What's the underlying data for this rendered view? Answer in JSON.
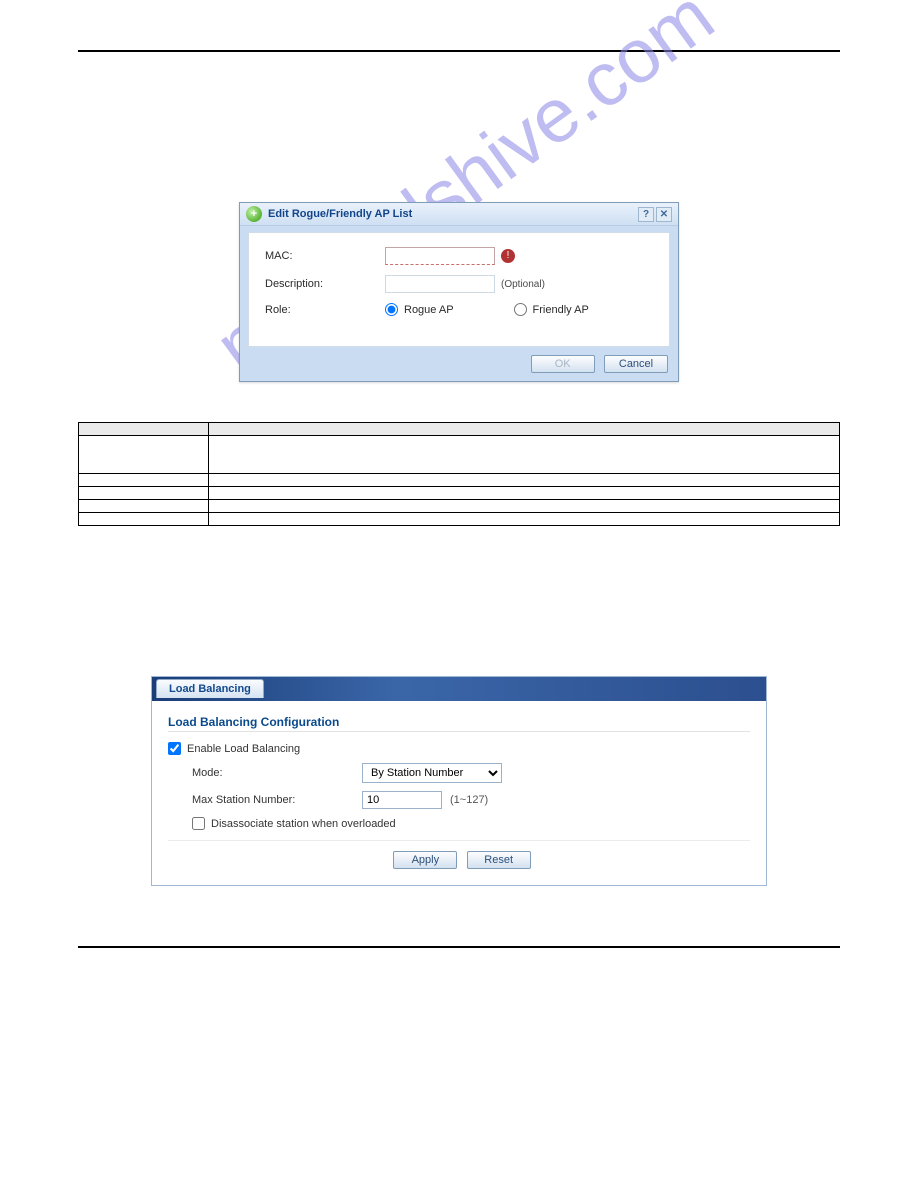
{
  "watermark": "manualshive.com",
  "dialog": {
    "title": "Edit Rogue/Friendly AP List",
    "fields": {
      "mac": {
        "label": "MAC:",
        "value": ""
      },
      "desc": {
        "label": "Description:",
        "value": "",
        "after": "(Optional)"
      },
      "role": {
        "label": "Role:",
        "opt_rogue": "Rogue AP",
        "opt_friendly": "Friendly AP"
      }
    },
    "buttons": {
      "ok": "OK",
      "cancel": "Cancel"
    }
  },
  "table": {
    "head": {
      "label": "",
      "desc": ""
    },
    "rows": [
      {
        "label": "",
        "desc": ""
      },
      {
        "label": "",
        "desc": ""
      },
      {
        "label": "",
        "desc": ""
      },
      {
        "label": "",
        "desc": ""
      },
      {
        "label": "",
        "desc": ""
      }
    ]
  },
  "panel": {
    "tab": "Load Balancing",
    "section": "Load Balancing Configuration",
    "enable": {
      "label": "Enable Load Balancing",
      "checked": true
    },
    "mode": {
      "label": "Mode:",
      "value": "By Station Number"
    },
    "max": {
      "label": "Max Station Number:",
      "value": "10",
      "range": "(1~127)"
    },
    "disassoc": {
      "label": "Disassociate station when overloaded",
      "checked": false
    },
    "buttons": {
      "apply": "Apply",
      "reset": "Reset"
    }
  }
}
